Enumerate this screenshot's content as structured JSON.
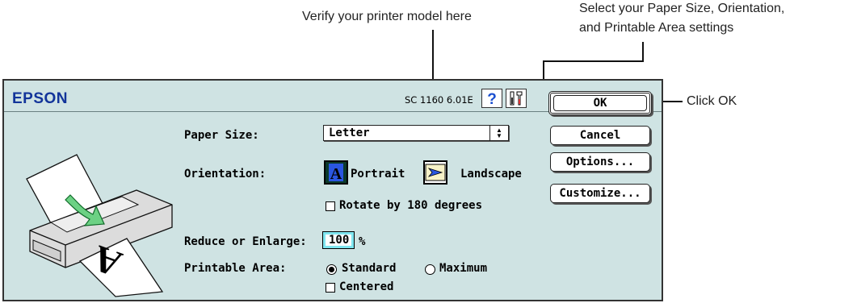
{
  "callouts": {
    "printer_model": "Verify your printer model here",
    "paper_settings_line1": "Select your Paper Size, Orientation,",
    "paper_settings_line2": "and Printable Area settings",
    "ok": "Click OK"
  },
  "dialog": {
    "brand": "EPSON",
    "model_version": "SC 1160 6.01E",
    "help_icon": "question-mark-icon",
    "tools_icon": "tools-icon",
    "paper_size": {
      "label": "Paper Size:",
      "value": "Letter"
    },
    "orientation": {
      "label": "Orientation:",
      "portrait": "Portrait",
      "landscape": "Landscape",
      "selected": "Portrait"
    },
    "rotate": {
      "label": "Rotate by 180 degrees",
      "checked": false
    },
    "reduce": {
      "label": "Reduce or Enlarge:",
      "value": "100",
      "unit": "%"
    },
    "printable_area": {
      "label": "Printable Area:",
      "standard": "Standard",
      "maximum": "Maximum",
      "selected": "Standard"
    },
    "centered": {
      "label": "Centered",
      "checked": false
    },
    "buttons": {
      "ok": "OK",
      "cancel": "Cancel",
      "options": "Options...",
      "customize": "Customize..."
    }
  },
  "colors": {
    "dialog_bg": "#cfe3e3",
    "brand": "#12349a",
    "focus_ring": "#7fe6f0"
  }
}
